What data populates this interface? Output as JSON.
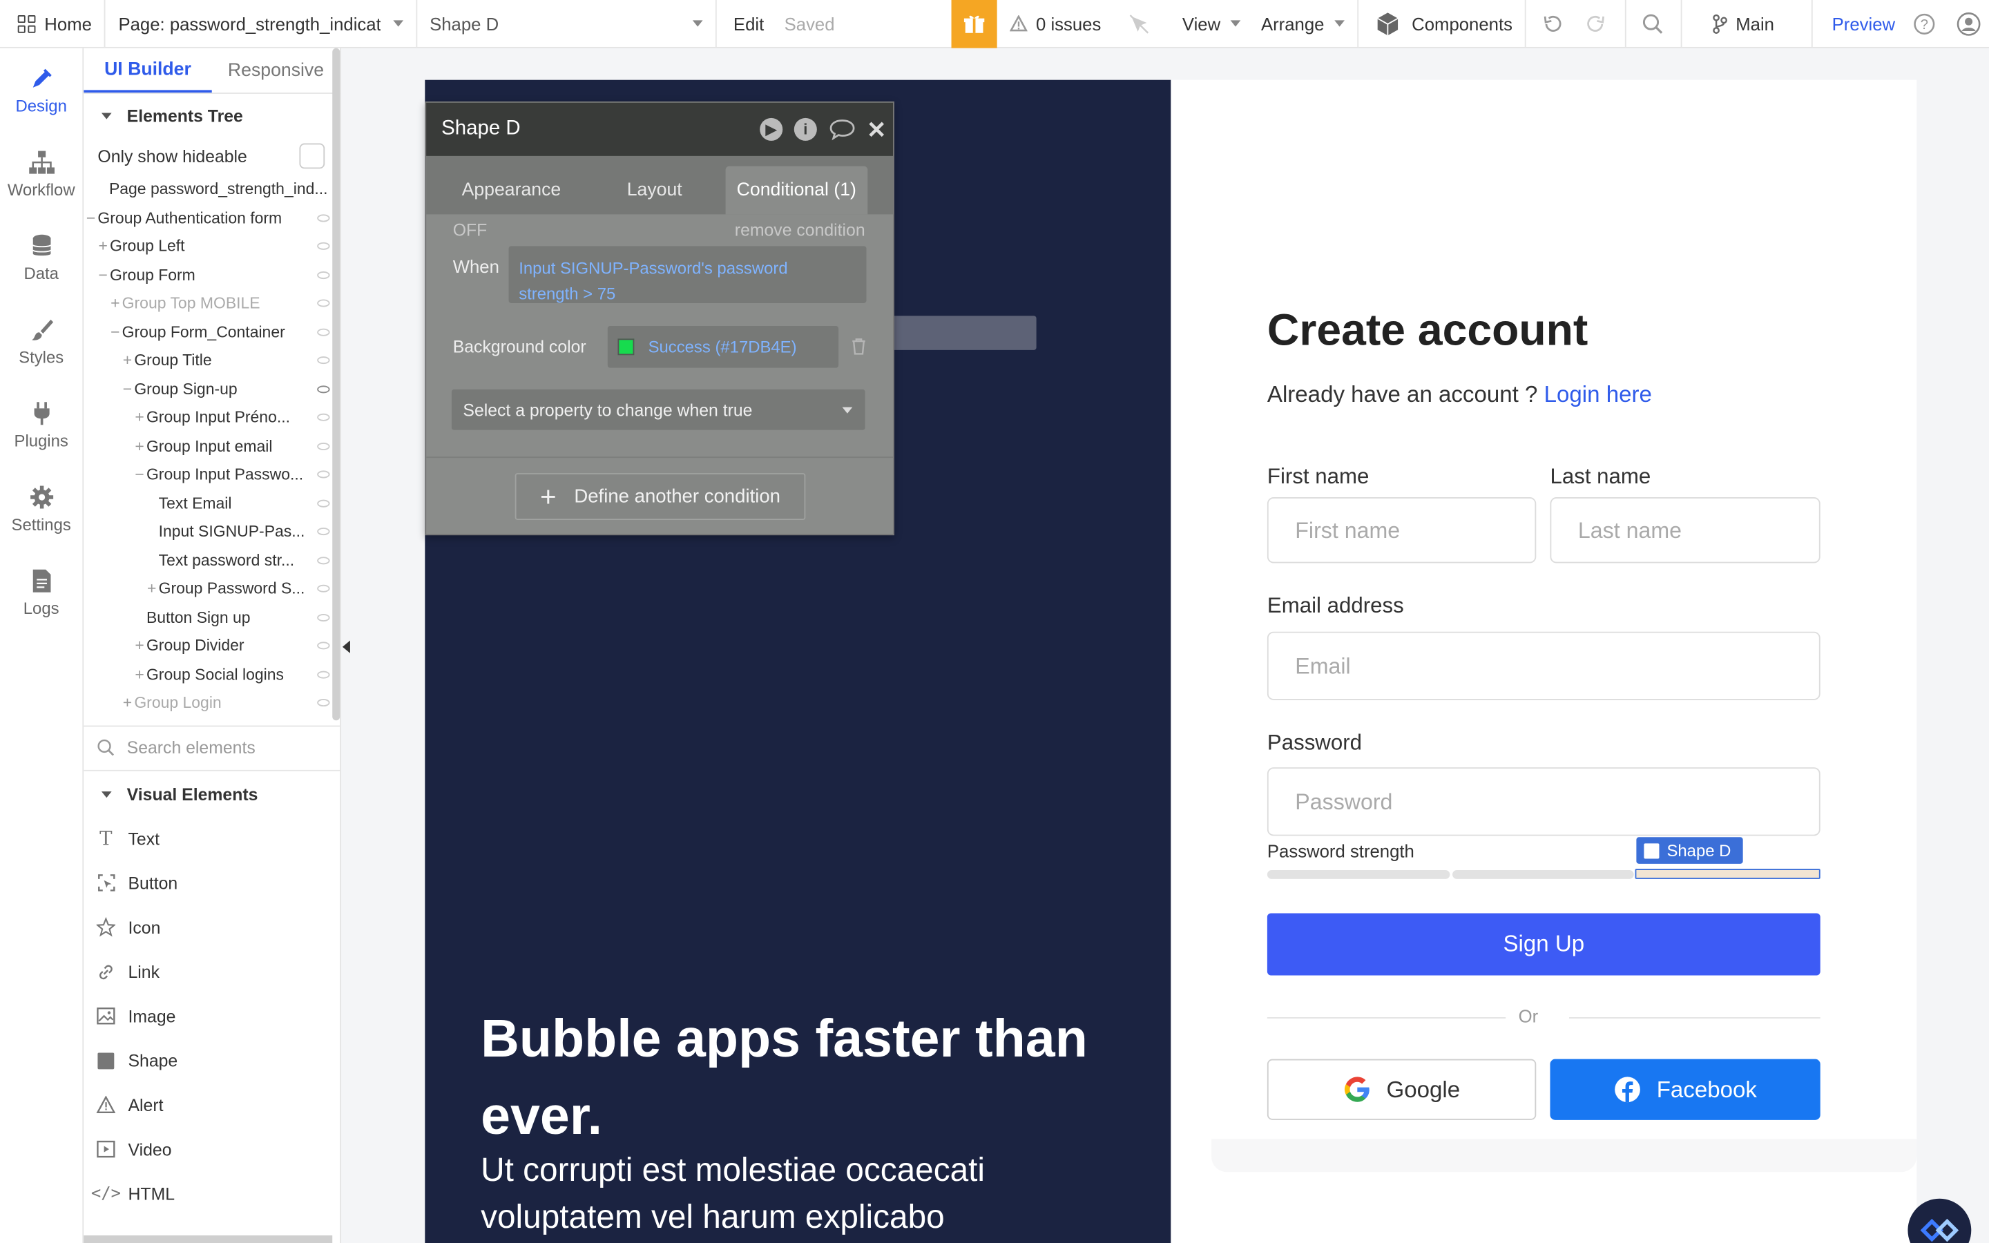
{
  "topbar": {
    "home": "Home",
    "page": "Page: password_strength_indicat",
    "element": "Shape D",
    "edit": "Edit",
    "saved": "Saved",
    "issues": "0 issues",
    "view": "View",
    "arrange": "Arrange",
    "components": "Components",
    "branch": "Main",
    "preview": "Preview"
  },
  "rail": {
    "items": [
      {
        "label": "Design",
        "icon": "pen-icon"
      },
      {
        "label": "Workflow",
        "icon": "workflow-icon"
      },
      {
        "label": "Data",
        "icon": "database-icon"
      },
      {
        "label": "Styles",
        "icon": "brush-icon"
      },
      {
        "label": "Plugins",
        "icon": "plug-icon"
      },
      {
        "label": "Settings",
        "icon": "gear-icon"
      },
      {
        "label": "Logs",
        "icon": "document-icon"
      }
    ]
  },
  "panel": {
    "tabs": [
      "UI Builder",
      "Responsive"
    ],
    "tree_title": "Elements Tree",
    "only_hideable": "Only show hideable",
    "tree": [
      {
        "label": "Page password_strength_ind...",
        "indent": 0,
        "prefix": "",
        "dim": false,
        "eye": false
      },
      {
        "label": "Group Authentication form",
        "indent": 0,
        "prefix": "−",
        "dim": false,
        "eye": true
      },
      {
        "label": "Group Left",
        "indent": 1,
        "prefix": "+",
        "dim": false,
        "eye": true
      },
      {
        "label": "Group Form",
        "indent": 1,
        "prefix": "−",
        "dim": false,
        "eye": true
      },
      {
        "label": "Group Top MOBILE",
        "indent": 2,
        "prefix": "+",
        "dim": true,
        "eye": true
      },
      {
        "label": "Group Form_Container",
        "indent": 2,
        "prefix": "−",
        "dim": false,
        "eye": true
      },
      {
        "label": "Group Title",
        "indent": 3,
        "prefix": "+",
        "dim": false,
        "eye": true
      },
      {
        "label": "Group Sign-up",
        "indent": 3,
        "prefix": "−",
        "dim": false,
        "eye": true,
        "eye_on": true
      },
      {
        "label": "Group Input Préno...",
        "indent": 4,
        "prefix": "+",
        "dim": false,
        "eye": true
      },
      {
        "label": "Group Input email",
        "indent": 4,
        "prefix": "+",
        "dim": false,
        "eye": true
      },
      {
        "label": "Group Input Passwo...",
        "indent": 4,
        "prefix": "−",
        "dim": false,
        "eye": true
      },
      {
        "label": "Text Email",
        "indent": 5,
        "prefix": "",
        "dim": false,
        "eye": true
      },
      {
        "label": "Input SIGNUP-Pas...",
        "indent": 5,
        "prefix": "",
        "dim": false,
        "eye": true
      },
      {
        "label": "Text password str...",
        "indent": 5,
        "prefix": "",
        "dim": false,
        "eye": true
      },
      {
        "label": "Group Password S...",
        "indent": 5,
        "prefix": "+",
        "dim": false,
        "eye": true
      },
      {
        "label": "Button Sign up",
        "indent": 4,
        "prefix": "",
        "dim": false,
        "eye": true
      },
      {
        "label": "Group Divider",
        "indent": 4,
        "prefix": "+",
        "dim": false,
        "eye": true
      },
      {
        "label": "Group Social logins",
        "indent": 4,
        "prefix": "+",
        "dim": false,
        "eye": true
      },
      {
        "label": "Group Login",
        "indent": 3,
        "prefix": "+",
        "dim": true,
        "eye": true
      }
    ],
    "search_placeholder": "Search elements",
    "visual_title": "Visual Elements",
    "visual": [
      {
        "label": "Text",
        "icon": "text-icon"
      },
      {
        "label": "Button",
        "icon": "button-icon"
      },
      {
        "label": "Icon",
        "icon": "star-icon"
      },
      {
        "label": "Link",
        "icon": "link-icon"
      },
      {
        "label": "Image",
        "icon": "image-icon"
      },
      {
        "label": "Shape",
        "icon": "shape-icon"
      },
      {
        "label": "Alert",
        "icon": "alert-icon"
      },
      {
        "label": "Video",
        "icon": "video-icon"
      },
      {
        "label": "HTML",
        "icon": "code-icon"
      }
    ]
  },
  "editor": {
    "title": "Shape D",
    "tabs": [
      "Appearance",
      "Layout",
      "Conditional (1)"
    ],
    "off": "OFF",
    "remove": "remove condition",
    "when": "When",
    "condition_line1": "Input SIGNUP-Password's password",
    "condition_line2": "strength > 75",
    "bg_label": "Background color",
    "bg_value": "Success (#17DB4E)",
    "bg_color": "#17DB4E",
    "select_prop": "Select a property to change when true",
    "define": "Define another condition"
  },
  "canvas": {
    "hero_title": "Bubble apps faster than ever.",
    "hero_sub": "Ut corrupti est molestiae occaecati voluptatem vel harum explicabo",
    "create": "Create account",
    "already": "Already have an account ?",
    "login": "Login here",
    "first_label": "First name",
    "first_ph": "First name",
    "last_label": "Last name",
    "last_ph": "Last name",
    "email_label": "Email address",
    "email_ph": "Email",
    "password_label": "Password",
    "password_ph": "Password",
    "pstrength": "Password strength",
    "shape_tag": "Shape D",
    "signup": "Sign Up",
    "or": "Or",
    "google": "Google",
    "facebook": "Facebook"
  },
  "colors": {
    "accent": "#2f5bea",
    "signup": "#3d5bf5",
    "facebook": "#1877f2",
    "dark": "#1b2341",
    "gift": "#f5a623"
  }
}
